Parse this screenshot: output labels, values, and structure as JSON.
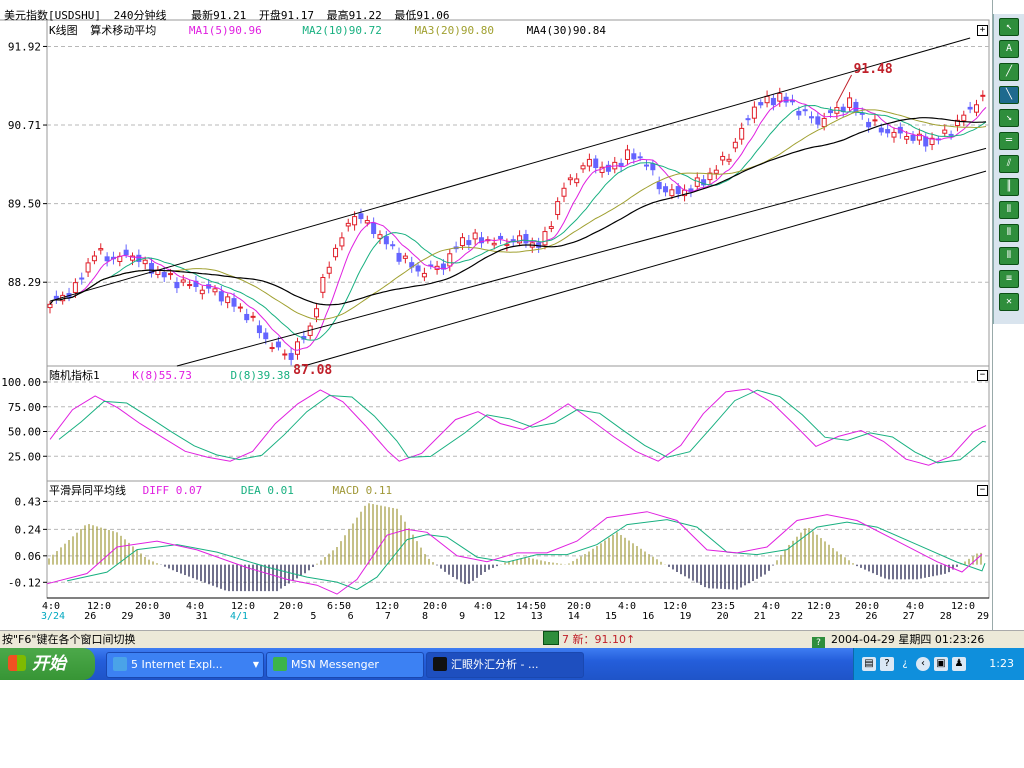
{
  "header": {
    "symbol": "美元指数[USDSHU]",
    "period": "240分钟线",
    "latest": "最新91.21",
    "open": "开盘91.17",
    "high": "最高91.22",
    "low": "最低91.06"
  },
  "price_panel": {
    "name": "K线图",
    "indicator": "算术移动平均",
    "ma1": "MA1(5)90.96",
    "ma2": "MA2(10)90.72",
    "ma3": "MA3(20)90.80",
    "ma4": "MA4(30)90.84",
    "y_ticks": [
      "91.92",
      "90.71",
      "89.50",
      "88.29"
    ],
    "high_label": "91.48",
    "low_label": "87.08"
  },
  "kd_panel": {
    "name": "随机指标1",
    "k": "K(8)55.73",
    "d": "D(8)39.38",
    "y_ticks": [
      "100.00",
      "75.00",
      "50.00",
      "25.00"
    ]
  },
  "macd_panel": {
    "name": "平滑异同平均线",
    "diff": "DIFF 0.07",
    "dea": "DEA 0.01",
    "macd": "MACD 0.11",
    "y_ticks": [
      "0.43",
      "0.24",
      "0.06",
      "-0.12"
    ]
  },
  "x_axis": {
    "times": [
      "4:0",
      "12:0",
      "20:0",
      "4:0",
      "12:0",
      "20:0",
      "6:50",
      "12:0",
      "20:0",
      "4:0",
      "14:50",
      "20:0",
      "4:0",
      "12:0",
      "23:5",
      "4:0",
      "12:0",
      "20:0",
      "4:0",
      "12:0"
    ],
    "dates": [
      "3/24",
      "26",
      "29",
      "30",
      "31",
      "4/1",
      "2",
      "5",
      "6",
      "7",
      "8",
      "9",
      "12",
      "13",
      "14",
      "15",
      "16",
      "19",
      "20",
      "21",
      "22",
      "23",
      "26",
      "27",
      "28",
      "29"
    ]
  },
  "colors": {
    "up": "#e0202a",
    "down": "#6464ff",
    "ma1": "#e020e0",
    "ma2": "#18b080",
    "ma3": "#a0a030",
    "ma4": "#000000",
    "trend": "#000000",
    "macd_pos": "#a09838",
    "macd_neg": "#101040",
    "accent": "#c0202a"
  },
  "chart_data": [
    {
      "type": "candlestick",
      "title": "美元指数[USDSHU] 240分钟线",
      "ylim": [
        87.0,
        92.05
      ],
      "y_ticks": [
        91.92,
        90.71,
        89.5,
        88.29
      ],
      "marked_extremes": {
        "high": 91.48,
        "low": 87.08
      },
      "price_path": [
        [
          0,
          87.95
        ],
        [
          8,
          88.2
        ],
        [
          14,
          88.75
        ],
        [
          20,
          88.65
        ],
        [
          26,
          88.72
        ],
        [
          30,
          88.55
        ],
        [
          40,
          88.3
        ],
        [
          52,
          88.15
        ],
        [
          62,
          87.8
        ],
        [
          70,
          87.3
        ],
        [
          76,
          87.15
        ],
        [
          82,
          87.6
        ],
        [
          88,
          88.6
        ],
        [
          96,
          89.35
        ],
        [
          102,
          89.1
        ],
        [
          108,
          88.8
        ],
        [
          116,
          88.45
        ],
        [
          124,
          88.55
        ],
        [
          130,
          88.95
        ],
        [
          136,
          88.95
        ],
        [
          142,
          88.9
        ],
        [
          148,
          88.95
        ],
        [
          155,
          88.85
        ],
        [
          162,
          89.75
        ],
        [
          170,
          90.15
        ],
        [
          176,
          90.0
        ],
        [
          182,
          90.25
        ],
        [
          188,
          90.15
        ],
        [
          192,
          89.75
        ],
        [
          198,
          89.65
        ],
        [
          206,
          89.85
        ],
        [
          214,
          90.25
        ],
        [
          222,
          91.0
        ],
        [
          230,
          91.15
        ],
        [
          236,
          90.95
        ],
        [
          242,
          90.75
        ],
        [
          248,
          90.95
        ],
        [
          252,
          91.05
        ],
        [
          258,
          90.75
        ],
        [
          264,
          90.6
        ],
        [
          270,
          90.55
        ],
        [
          276,
          90.45
        ],
        [
          282,
          90.55
        ],
        [
          288,
          90.85
        ],
        [
          295,
          91.21
        ]
      ],
      "moving_averages": [
        {
          "name": "MA1(5)",
          "period": 5,
          "last": 90.96
        },
        {
          "name": "MA2(10)",
          "period": 10,
          "last": 90.72
        },
        {
          "name": "MA3(20)",
          "period": 20,
          "last": 90.8
        },
        {
          "name": "MA4(30)",
          "period": 30,
          "last": 90.84
        }
      ]
    },
    {
      "type": "line",
      "title": "随机指标1",
      "ylim": [
        0,
        100
      ],
      "y_ticks": [
        100,
        75,
        50,
        25
      ],
      "series": [
        {
          "name": "K(8)",
          "last": 55.73
        },
        {
          "name": "D(8)",
          "last": 39.38
        }
      ]
    },
    {
      "type": "bar",
      "title": "平滑异同平均线",
      "ylim": [
        -0.22,
        0.46
      ],
      "y_ticks": [
        0.43,
        0.24,
        0.06,
        -0.12
      ],
      "series": [
        {
          "name": "DIFF",
          "last": 0.07
        },
        {
          "name": "DEA",
          "last": 0.01
        },
        {
          "name": "MACD",
          "last": 0.11
        }
      ]
    }
  ],
  "status": {
    "hint": "按\"F6\"键在各个窗口间切换",
    "quote": "7 新：91.10↑",
    "datetime": "2004-04-29 星期四  01:23:26"
  },
  "taskbar": {
    "start": "开始",
    "tasks": [
      {
        "label": "5 Internet Expl..."
      },
      {
        "label": "MSN Messenger"
      },
      {
        "label": "汇眼外汇分析 - ..."
      }
    ],
    "clock": "1:23"
  }
}
